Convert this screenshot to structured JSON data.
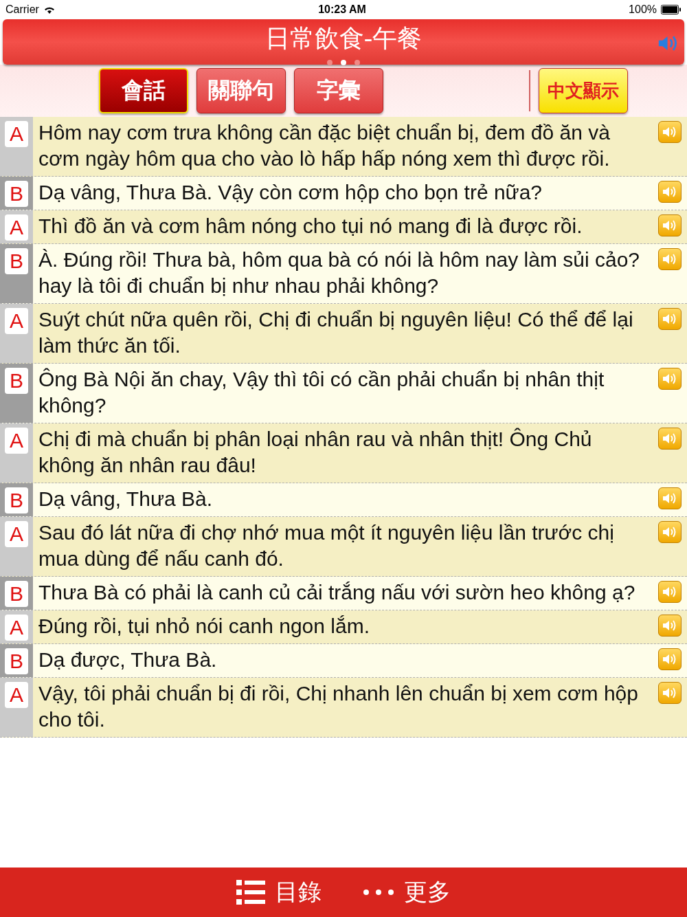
{
  "status_bar": {
    "carrier": "Carrier",
    "time": "10:23 AM",
    "battery": "100%"
  },
  "header": {
    "title": "日常飲食-午餐",
    "page_dots": [
      {
        "selected": false
      },
      {
        "selected": true
      },
      {
        "selected": false
      }
    ]
  },
  "tabs": [
    {
      "label": "會話",
      "selected": true
    },
    {
      "label": "關聯句",
      "selected": false
    },
    {
      "label": "字彙",
      "selected": false
    }
  ],
  "chinese_toggle": {
    "label": "中文顯示"
  },
  "dialogue": [
    {
      "speaker": "A",
      "kind": "a",
      "text": "Hôm nay cơm trưa không cần đặc biệt chuẩn bị, đem đồ ăn và cơm ngày hôm qua cho vào lò hấp hấp nóng xem thì được rồi."
    },
    {
      "speaker": "B",
      "kind": "b",
      "text": "Dạ vâng, Thưa Bà. Vậy còn cơm hộp cho bọn trẻ nữa?"
    },
    {
      "speaker": "A",
      "kind": "a",
      "text": "Thì đồ ăn và cơm hâm nóng cho tụi nó mang đi là được rồi."
    },
    {
      "speaker": "B",
      "kind": "b",
      "text": "À. Đúng rồi! Thưa bà, hôm qua bà có nói là hôm nay làm sủi cảo? hay là tôi đi chuẩn bị như nhau phải không?"
    },
    {
      "speaker": "A",
      "kind": "a",
      "text": "Suýt chút nữa quên rồi, Chị đi chuẩn bị nguyên liệu! Có thể để lại làm thức ăn tối."
    },
    {
      "speaker": "B",
      "kind": "b",
      "text": "Ông Bà Nội ăn chay, Vậy thì tôi có cần phải chuẩn bị nhân thịt không?"
    },
    {
      "speaker": "A",
      "kind": "a",
      "text": "Chị đi mà chuẩn bị phân loại nhân rau và nhân thịt! Ông Chủ không ăn nhân rau đâu!"
    },
    {
      "speaker": "B",
      "kind": "b",
      "text": "Dạ vâng, Thưa Bà."
    },
    {
      "speaker": "A",
      "kind": "a",
      "text": "Sau đó lát nữa đi chợ nhớ mua một ít nguyên liệu lần trước chị mua dùng để nấu canh đó."
    },
    {
      "speaker": "B",
      "kind": "b",
      "text": "Thưa Bà có phải là canh củ cải trắng nấu với sườn heo không ạ?"
    },
    {
      "speaker": "A",
      "kind": "a",
      "text": "Đúng rồi, tụi nhỏ nói canh ngon lắm."
    },
    {
      "speaker": "B",
      "kind": "b",
      "text": "Dạ được, Thưa Bà."
    },
    {
      "speaker": "A",
      "kind": "a",
      "text": "Vậy, tôi phải chuẩn bị đi rồi, Chị nhanh lên chuẩn bị xem cơm hộp cho tôi."
    }
  ],
  "bottom_bar": {
    "items": [
      {
        "kind": "list",
        "label": "目錄"
      },
      {
        "kind": "more",
        "label": "更多"
      }
    ]
  }
}
